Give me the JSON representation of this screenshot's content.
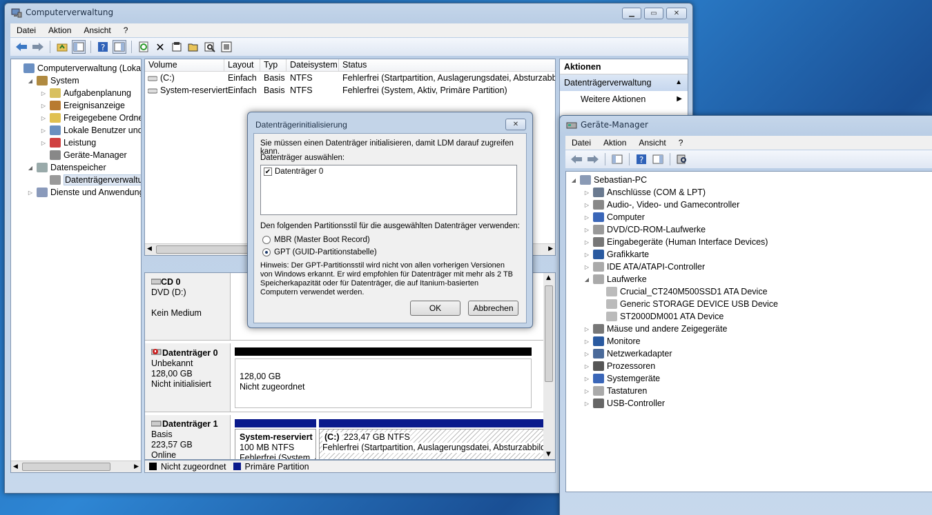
{
  "computer_management": {
    "title": "Computerverwaltung",
    "menu": [
      "Datei",
      "Aktion",
      "Ansicht",
      "?"
    ],
    "tree": [
      {
        "label": "Computerverwaltung (Lokal)",
        "level": 0,
        "expander": "",
        "icon": "computer-management-icon"
      },
      {
        "label": "System",
        "level": 1,
        "expander": "◢",
        "icon": "tools-icon"
      },
      {
        "label": "Aufgabenplanung",
        "level": 2,
        "expander": "▷",
        "icon": "clock-icon"
      },
      {
        "label": "Ereignisanzeige",
        "level": 2,
        "expander": "▷",
        "icon": "event-viewer-icon"
      },
      {
        "label": "Freigegebene Ordner",
        "level": 2,
        "expander": "▷",
        "icon": "shared-folder-icon"
      },
      {
        "label": "Lokale Benutzer und Gruppen",
        "level": 2,
        "expander": "▷",
        "icon": "users-icon"
      },
      {
        "label": "Leistung",
        "level": 2,
        "expander": "▷",
        "icon": "performance-icon"
      },
      {
        "label": "Geräte-Manager",
        "level": 2,
        "expander": "",
        "icon": "device-manager-icon"
      },
      {
        "label": "Datenspeicher",
        "level": 1,
        "expander": "◢",
        "icon": "storage-icon"
      },
      {
        "label": "Datenträgerverwaltung",
        "level": 2,
        "expander": "",
        "icon": "disk-management-icon",
        "selected": true
      },
      {
        "label": "Dienste und Anwendungen",
        "level": 1,
        "expander": "▷",
        "icon": "services-icon"
      }
    ],
    "volume_table": {
      "columns": [
        "Volume",
        "Layout",
        "Typ",
        "Dateisystem",
        "Status"
      ],
      "rows": [
        [
          "(C:)",
          "Einfach",
          "Basis",
          "NTFS",
          "Fehlerfrei (Startpartition, Auslagerungsdatei, Absturzabbild"
        ],
        [
          "System-reserviert",
          "Einfach",
          "Basis",
          "NTFS",
          "Fehlerfrei (System, Aktiv, Primäre Partition)"
        ]
      ]
    },
    "disks": {
      "cd0": {
        "name": "CD 0",
        "line1": "DVD (D:)",
        "line2": "Kein Medium"
      },
      "disk0": {
        "name": "Datenträger 0",
        "line1": "Unbekannt",
        "line2": "128,00 GB",
        "line3": "Nicht initialisiert",
        "part_size": "128,00 GB",
        "part_status": "Nicht zugeordnet"
      },
      "disk1": {
        "name": "Datenträger 1",
        "line1": "Basis",
        "line2": "223,57 GB",
        "line3": "Online",
        "p1_name": "System-reserviert",
        "p1_size": "100 MB NTFS",
        "p1_status": "Fehlerfrei (System, Aktiv, Primäre Partition)",
        "p2_name": "(C:)",
        "p2_size": "223,47 GB NTFS",
        "p2_status": "Fehlerfrei (Startpartition, Auslagerungsdatei, Absturzabbild, Primäre Partition)"
      }
    },
    "legend": [
      {
        "label": "Nicht zugeordnet",
        "color": "#000000"
      },
      {
        "label": "Primäre Partition",
        "color": "#0a1a8c"
      }
    ],
    "actions": {
      "header": "Aktionen",
      "section": "Datenträgerverwaltung",
      "item": "Weitere Aktionen"
    }
  },
  "dialog": {
    "title": "Datenträgerinitialisierung",
    "intro": "Sie müssen einen Datenträger initialisieren, damit LDM darauf zugreifen kann.",
    "select_label": "Datenträger auswählen:",
    "disk_item": "Datenträger 0",
    "style_label": "Den folgenden Partitionsstil für die ausgewählten Datenträger verwenden:",
    "mbr": "MBR (Master Boot Record)",
    "gpt": "GPT (GUID-Partitionstabelle)",
    "hint": "Hinweis: Der GPT-Partitionsstil wird nicht von allen vorherigen Versionen von Windows erkannt. Er wird empfohlen für Datenträger mit mehr als 2 TB Speicherkapazität oder für Datenträger, die auf Itanium-basierten Computern verwendet werden.",
    "ok": "OK",
    "cancel": "Abbrechen"
  },
  "device_manager": {
    "title": "Geräte-Manager",
    "menu": [
      "Datei",
      "Aktion",
      "Ansicht",
      "?"
    ],
    "root": "Sebastian-PC",
    "categories": [
      "Anschlüsse (COM & LPT)",
      "Audio-, Video- und Gamecontroller",
      "Computer",
      "DVD/CD-ROM-Laufwerke",
      "Eingabegeräte (Human Interface Devices)",
      "Grafikkarte",
      "IDE ATA/ATAPI-Controller",
      "Laufwerke"
    ],
    "drives": [
      "Crucial_CT240M500SSD1 ATA Device",
      "Generic STORAGE DEVICE USB Device",
      "ST2000DM001 ATA Device"
    ],
    "categories_after": [
      "Mäuse und andere Zeigegeräte",
      "Monitore",
      "Netzwerkadapter",
      "Prozessoren",
      "Systemgeräte",
      "Tastaturen",
      "USB-Controller"
    ]
  }
}
